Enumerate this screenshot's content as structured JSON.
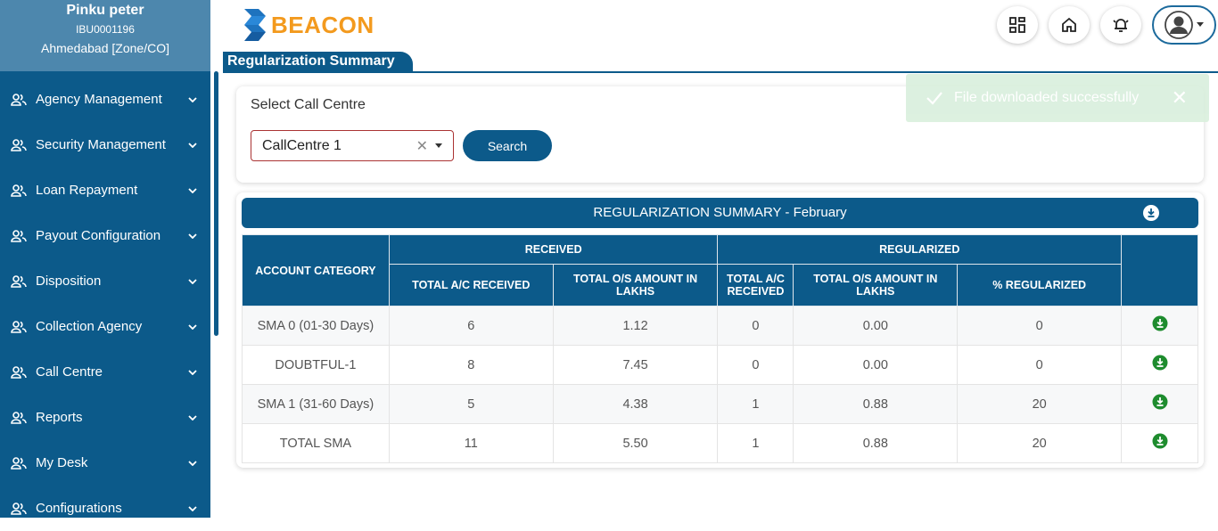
{
  "user": {
    "name": "Pinku peter",
    "code": "IBU0001196",
    "location": "Ahmedabad [Zone/CO]"
  },
  "nav": [
    {
      "label": "Agency Management"
    },
    {
      "label": "Security Management"
    },
    {
      "label": "Loan Repayment"
    },
    {
      "label": "Payout Configuration"
    },
    {
      "label": "Disposition"
    },
    {
      "label": "Collection Agency"
    },
    {
      "label": "Call Centre"
    },
    {
      "label": "Reports"
    },
    {
      "label": "My Desk"
    },
    {
      "label": "Configurations"
    }
  ],
  "brand": {
    "name": "BEACON",
    "primary_color": "#0c5a8a",
    "accent_color": "#f39a1e"
  },
  "header_icons": [
    "grid-icon",
    "home-icon",
    "bell-icon",
    "user-avatar-icon"
  ],
  "page": {
    "title": "Regularization Summary"
  },
  "filter": {
    "label": "Select Call Centre",
    "selected": "CallCentre 1",
    "search_label": "Search"
  },
  "toast": {
    "message": "File downloaded successfully",
    "close": "✕"
  },
  "summary": {
    "title": "REGULARIZATION SUMMARY - February",
    "headers": {
      "account_category": "ACCOUNT CATEGORY",
      "received": "RECEIVED",
      "regularized": "REGULARIZED",
      "total_ac_received": "TOTAL A/C RECEIVED",
      "total_os_amount": "TOTAL O/S AMOUNT IN LAKHS",
      "total_ac_received_short": "TOTAL A/C RECEIVED",
      "total_os_amount_reg": "TOTAL O/S AMOUNT IN LAKHS",
      "pct_regularized": "% REGULARIZED"
    },
    "rows": [
      {
        "category": "SMA 0 (01-30 Days)",
        "rec_ac": "6",
        "rec_amt": "1.12",
        "reg_ac": "0",
        "reg_amt": "0.00",
        "pct": "0"
      },
      {
        "category": "DOUBTFUL-1",
        "rec_ac": "8",
        "rec_amt": "7.45",
        "reg_ac": "0",
        "reg_amt": "0.00",
        "pct": "0"
      },
      {
        "category": "SMA 1 (31-60 Days)",
        "rec_ac": "5",
        "rec_amt": "4.38",
        "reg_ac": "1",
        "reg_amt": "0.88",
        "pct": "20"
      },
      {
        "category": "TOTAL SMA",
        "rec_ac": "11",
        "rec_amt": "5.50",
        "reg_ac": "1",
        "reg_amt": "0.88",
        "pct": "20"
      }
    ]
  }
}
